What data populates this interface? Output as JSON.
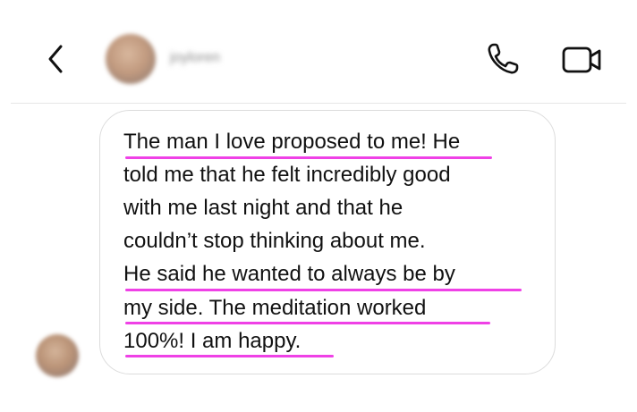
{
  "header": {
    "username": "joyloren",
    "icons": {
      "back": "chevron-left-icon",
      "call": "phone-icon",
      "video": "video-camera-icon"
    }
  },
  "message": {
    "lines": [
      "The man I love proposed to me! He",
      "told me that he felt incredibly good",
      "with me last night and that he",
      "couldn’t stop thinking about me.",
      "He said he wanted to always be by",
      "my side. The meditation worked",
      "100%! I am happy."
    ]
  },
  "colors": {
    "highlight_underline": "#ef41e6",
    "bubble_border": "#dcdcdc",
    "text": "#111111"
  }
}
